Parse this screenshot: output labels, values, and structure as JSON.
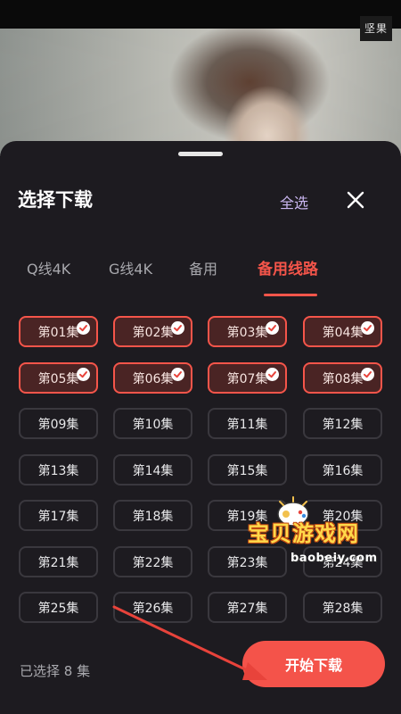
{
  "watermark": "坚果",
  "sheet": {
    "title": "选择下载",
    "select_all": "全选"
  },
  "tabs": [
    {
      "label": "Q线4K",
      "active": false
    },
    {
      "label": "G线4K",
      "active": false
    },
    {
      "label": "备用",
      "active": false
    },
    {
      "label": "备用线路",
      "active": true
    }
  ],
  "episodes": [
    {
      "label": "第01集",
      "selected": true
    },
    {
      "label": "第02集",
      "selected": true
    },
    {
      "label": "第03集",
      "selected": true
    },
    {
      "label": "第04集",
      "selected": true
    },
    {
      "label": "第05集",
      "selected": true
    },
    {
      "label": "第06集",
      "selected": true
    },
    {
      "label": "第07集",
      "selected": true
    },
    {
      "label": "第08集",
      "selected": true
    },
    {
      "label": "第09集",
      "selected": false
    },
    {
      "label": "第10集",
      "selected": false
    },
    {
      "label": "第11集",
      "selected": false
    },
    {
      "label": "第12集",
      "selected": false
    },
    {
      "label": "第13集",
      "selected": false
    },
    {
      "label": "第14集",
      "selected": false
    },
    {
      "label": "第15集",
      "selected": false
    },
    {
      "label": "第16集",
      "selected": false
    },
    {
      "label": "第17集",
      "selected": false
    },
    {
      "label": "第18集",
      "selected": false
    },
    {
      "label": "第19集",
      "selected": false
    },
    {
      "label": "第20集",
      "selected": false
    },
    {
      "label": "第21集",
      "selected": false
    },
    {
      "label": "第22集",
      "selected": false
    },
    {
      "label": "第23集",
      "selected": false
    },
    {
      "label": "第24集",
      "selected": false
    },
    {
      "label": "第25集",
      "selected": false
    },
    {
      "label": "第26集",
      "selected": false
    },
    {
      "label": "第27集",
      "selected": false
    },
    {
      "label": "第28集",
      "selected": false
    }
  ],
  "footer": {
    "selected_count_label": "已选择 8 集",
    "download_label": "开始下载"
  },
  "overlay_brand": {
    "name": "宝贝游戏网",
    "url": "baobeiy.com"
  },
  "colors": {
    "accent": "#f5554a",
    "sheet_bg": "#1d1b20",
    "select_all": "#c9b6f0"
  }
}
